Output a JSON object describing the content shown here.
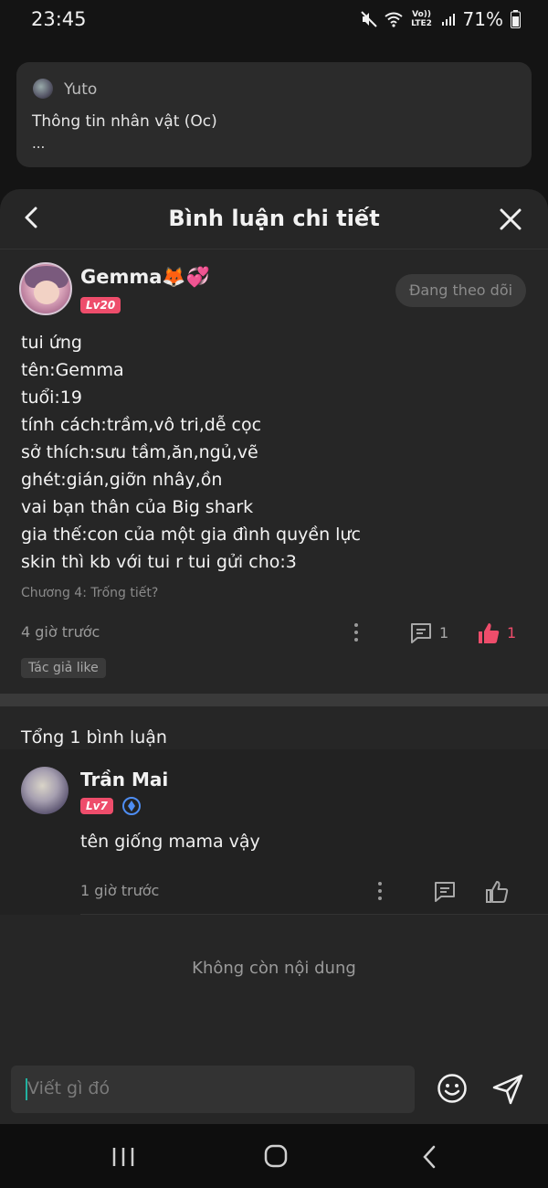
{
  "status_bar": {
    "time": "23:45",
    "network": "Vo)) LTE2",
    "battery": "71%"
  },
  "background_post": {
    "username": "Yuto",
    "title": "Thông tin nhân vật (Oc)",
    "ellipsis": "..."
  },
  "sheet": {
    "title": "Bình luận chi tiết",
    "back_icon": "chevron-left-icon",
    "close_icon": "close-icon"
  },
  "main_comment": {
    "author": "Gemma🦊💞",
    "level": "Lv20",
    "follow_label": "Đang theo dõi",
    "lines": [
      "tui ứng",
      "tên:Gemma",
      "tuổi:19",
      "tính cách:trầm,vô tri,dễ cọc",
      "sở thích:sưu tầm,ăn,ngủ,vẽ",
      "ghét:gián,giỡn nhây,ồn",
      "vai bạn thân của Big shark",
      "gia thế:con của một gia đình quyền lực",
      "skin thì kb với tui r tui gửi cho:3"
    ],
    "chapter": "Chương 4: Trống tiết?",
    "time": "4 giờ trước",
    "reply_count": "1",
    "like_count": "1",
    "author_like_tag": "Tác giả like",
    "liked_color": "#ee4d6b"
  },
  "replies": {
    "total_label": "Tổng 1 bình luận",
    "items": [
      {
        "author": "Trần Mai",
        "level": "Lv7",
        "text": "tên giống mama vậy",
        "time": "1 giờ trước"
      }
    ]
  },
  "end_text": "Không còn nội dung",
  "composer": {
    "placeholder": "Viết gì đó",
    "emoji_icon": "smiley-icon",
    "send_icon": "send-icon"
  },
  "nav": {
    "recent_icon": "recent-apps-icon",
    "home_icon": "home-icon",
    "back_icon": "back-icon"
  }
}
